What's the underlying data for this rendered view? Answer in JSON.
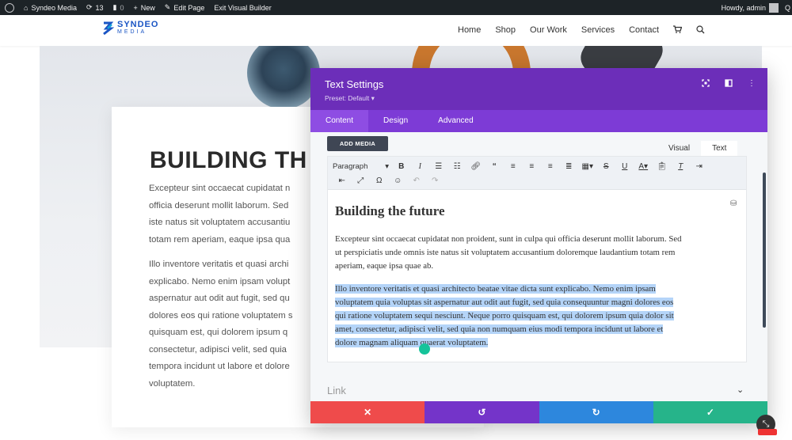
{
  "admin_bar": {
    "site_name": "Syndeo Media",
    "updates_count": "13",
    "comments_count": "0",
    "new_label": "New",
    "edit_page_label": "Edit Page",
    "exit_builder_label": "Exit Visual Builder",
    "greeting": "Howdy, admin"
  },
  "site_header": {
    "logo_line1": "SYNDEO",
    "logo_line2": "MEDIA",
    "nav": [
      "Home",
      "Shop",
      "Our Work",
      "Services",
      "Contact"
    ]
  },
  "page": {
    "heading": "BUILDING TH",
    "para1_lines": [
      "Excepteur sint occaecat cupidatat n",
      "officia deserunt mollit laborum. Sed",
      "iste natus sit voluptatem accusantiu",
      "totam rem aperiam, eaque ipsa qua"
    ],
    "para2_lines": [
      "Illo inventore veritatis et quasi archi",
      "explicabo. Nemo enim ipsam volupt",
      "aspernatur aut odit aut fugit, sed qu",
      "dolores eos qui ratione voluptatem s",
      "quisquam est, qui dolorem ipsum q",
      "consectetur, adipisci velit, sed quia",
      "tempora incidunt ut labore et dolore",
      "voluptatem."
    ]
  },
  "modal": {
    "title": "Text Settings",
    "preset": "Preset: Default ▾",
    "tabs": [
      "Content",
      "Design",
      "Advanced"
    ],
    "add_media": "ADD MEDIA",
    "editor_tabs": [
      "Visual",
      "Text"
    ],
    "format_select": "Paragraph",
    "content": {
      "heading": "Building the future",
      "para1_lines": [
        "Excepteur sint occaecat cupidatat non proident, sunt in culpa qui officia deserunt mollit laborum. Sed",
        "ut perspiciatis unde omnis iste natus sit voluptatem accusantium doloremque laudantium totam rem",
        "aperiam, eaque ipsa quae ab."
      ],
      "para2_lines": [
        "Illo inventore veritatis et quasi architecto beatae vitae dicta sunt explicabo. Nemo enim ipsam",
        "voluptatem quia voluptas sit aspernatur aut odit aut fugit, sed quia consequuntur magni dolores eos",
        "qui ratione voluptatem sequi nesciunt. Neque porro quisquam est, qui dolorem ipsum quia dolor sit",
        "amet, consectetur, adipisci velit, sed quia non numquam eius modi tempora incidunt ut labore et",
        "dolore magnam aliquam quaerat voluptatem."
      ]
    },
    "link_section": "Link"
  },
  "colors": {
    "modal_header": "#6c2eb9",
    "modal_tabs": "#7d3bd6",
    "cancel": "#ef4b4b",
    "undo": "#7434c9",
    "redo": "#2d87dd",
    "save": "#26b48a"
  }
}
